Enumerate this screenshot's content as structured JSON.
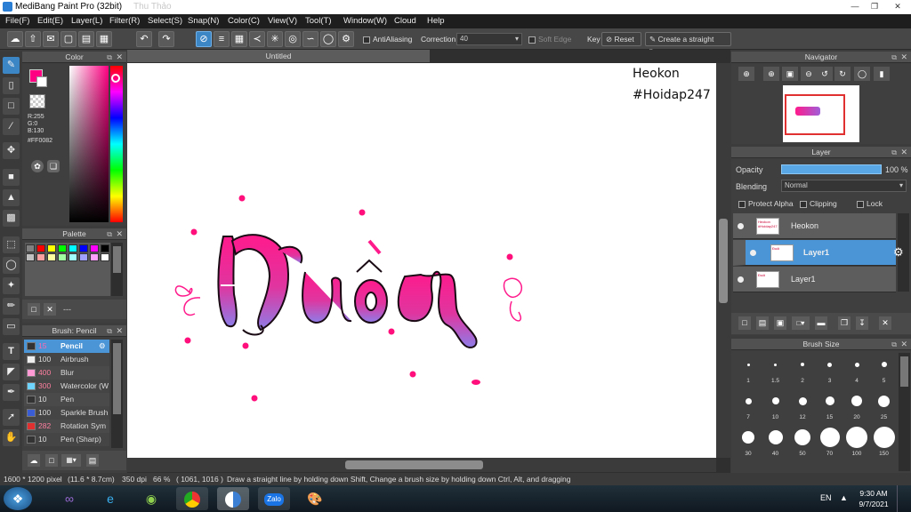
{
  "window": {
    "title": "MediBang Paint Pro (32bit)",
    "ghost_title": "Thu Thảo"
  },
  "menu": [
    "File(F)",
    "Edit(E)",
    "Layer(L)",
    "Filter(R)",
    "Select(S)",
    "Snap(N)",
    "Color(C)",
    "View(V)",
    "Tool(T)",
    "Window(W)",
    "Cloud",
    "Help"
  ],
  "toolbar": {
    "antialiasing": "AntiAliasing",
    "correction_label": "Correction",
    "correction_value": "40",
    "soft_edge": "Soft Edge",
    "key_label": "Key",
    "reset": "Reset",
    "straight_line": "Create a straight line"
  },
  "color_panel": {
    "title": "Color",
    "r": "R:255",
    "g": "G:0",
    "b": "B:130",
    "hex": "#FF0082",
    "main_color": "#FF0082"
  },
  "palette_panel": {
    "title": "Palette",
    "swatches": [
      "#808080",
      "#ff0000",
      "#ffff00",
      "#00ff00",
      "#00ffff",
      "#0000ff",
      "#ff00ff",
      "#000000",
      "#c0c0c0",
      "#ffa0a0",
      "#ffffa0",
      "#a0ffa0",
      "#a0ffff",
      "#a0a0ff",
      "#ffa0ff",
      "#ffffff"
    ],
    "dashes": "---"
  },
  "brush_panel": {
    "title": "Brush: Pencil",
    "brushes": [
      {
        "size": "15",
        "name": "Pencil",
        "color": "#333333",
        "active": true
      },
      {
        "size": "100",
        "name": "Airbrush",
        "color": "#eeeeee",
        "active": false
      },
      {
        "size": "400",
        "name": "Blur",
        "color": "#ff9ad5",
        "active": false
      },
      {
        "size": "300",
        "name": "Watercolor (W",
        "color": "#6fd3ff",
        "active": false
      },
      {
        "size": "10",
        "name": "Pen",
        "color": "#333333",
        "active": false
      },
      {
        "size": "100",
        "name": "Sparkle Brush",
        "color": "#3a5dd6",
        "active": false
      },
      {
        "size": "282",
        "name": "Rotation Sym",
        "color": "#e03030",
        "active": false
      },
      {
        "size": "10",
        "name": "Pen (Sharp)",
        "color": "#333333",
        "active": false
      }
    ]
  },
  "document": {
    "tab": "Untitled",
    "watermark_line1": "Heokon",
    "watermark_line2": "#Hoidap247"
  },
  "navigator": {
    "title": "Navigator"
  },
  "layer_panel": {
    "title": "Layer",
    "opacity_label": "Opacity",
    "opacity_value": "100 %",
    "blending_label": "Blending",
    "blending_value": "Normal",
    "protect_alpha": "Protect Alpha",
    "clipping": "Clipping",
    "lock": "Lock",
    "layers": [
      {
        "name": "Heokon",
        "thumb": "Heokon #Hoidap247",
        "selected": false
      },
      {
        "name": "Layer1",
        "thumb": "Đuôi",
        "selected": true
      },
      {
        "name": "Layer1",
        "thumb": "Đuôi",
        "selected": false
      }
    ]
  },
  "brush_size_panel": {
    "title": "Brush Size",
    "sizes": [
      "1",
      "1.5",
      "2",
      "3",
      "4",
      "5",
      "7",
      "10",
      "12",
      "15",
      "20",
      "25",
      "30",
      "40",
      "50",
      "70",
      "100",
      "150"
    ]
  },
  "status": {
    "dimensions": "1600 * 1200 pixel",
    "physical": "(11.6 * 8.7cm)",
    "dpi": "350 dpi",
    "zoom": "66 %",
    "cursor": "( 1061, 1016 )",
    "hint": "Draw a straight line by holding down Shift, Change a brush size by holding down Ctrl, Alt, and dragging"
  },
  "taskbar": {
    "lang": "EN",
    "time": "9:30 AM",
    "date": "9/7/2021",
    "zalo": "Zalo"
  }
}
